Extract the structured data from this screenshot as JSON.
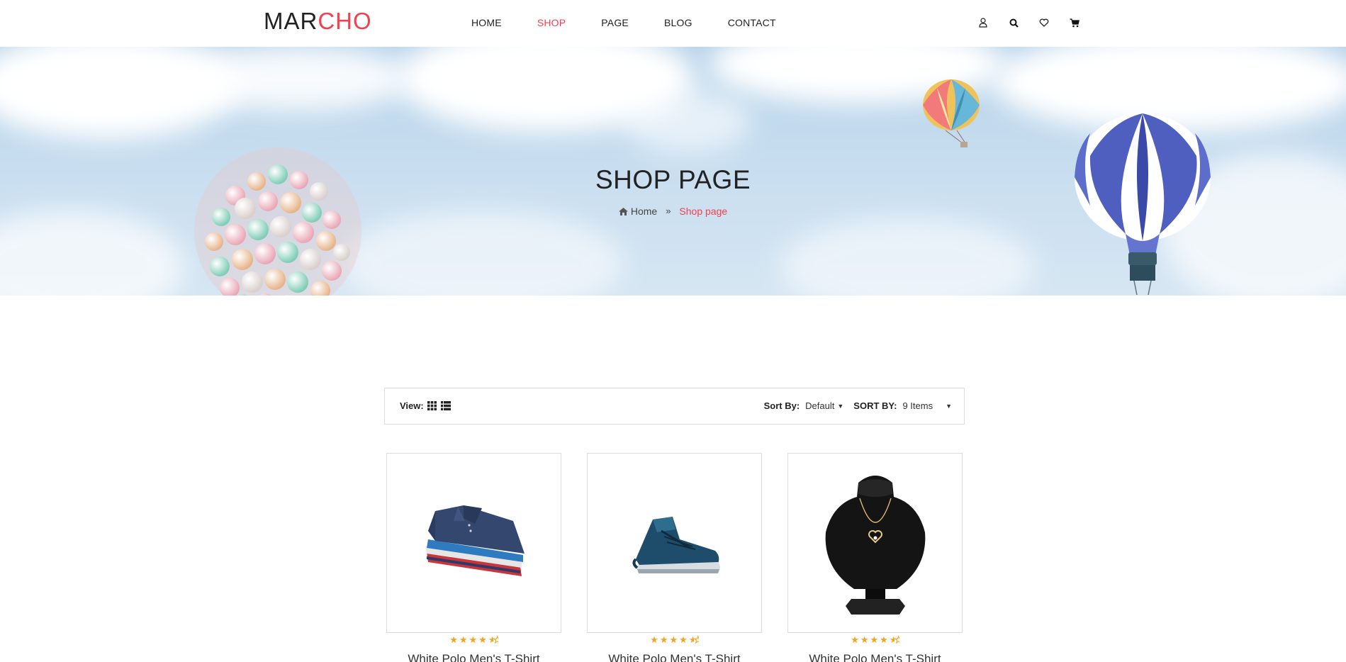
{
  "header": {
    "logo_part1": "MAR",
    "logo_part2": "CHO",
    "nav": [
      {
        "label": "HOME",
        "active": false
      },
      {
        "label": "SHOP",
        "active": true
      },
      {
        "label": "PAGE",
        "active": false
      },
      {
        "label": "BLOG",
        "active": false
      },
      {
        "label": "CONTACT",
        "active": false
      }
    ],
    "icons": [
      "user-icon",
      "search-icon",
      "heart-icon",
      "cart-icon"
    ]
  },
  "banner": {
    "title": "SHOP PAGE",
    "breadcrumb_home": "Home",
    "breadcrumb_current": "Shop page"
  },
  "toolbar": {
    "view_label": "View:",
    "sort_label": "Sort By:",
    "sort_value": "Default",
    "count_label": "SORT BY:",
    "count_value": "9 Items"
  },
  "products": [
    {
      "name": "White Polo Men's T-Shirt",
      "rating": 4.5,
      "image": "folded-polo-shirts"
    },
    {
      "name": "White Polo Men's T-Shirt",
      "rating": 4.5,
      "image": "blue-sneaker"
    },
    {
      "name": "White Polo Men's T-Shirt",
      "rating": 4.5,
      "image": "necklace-on-bust"
    }
  ],
  "colors": {
    "accent": "#f3404f",
    "star": "#f7a21b"
  }
}
